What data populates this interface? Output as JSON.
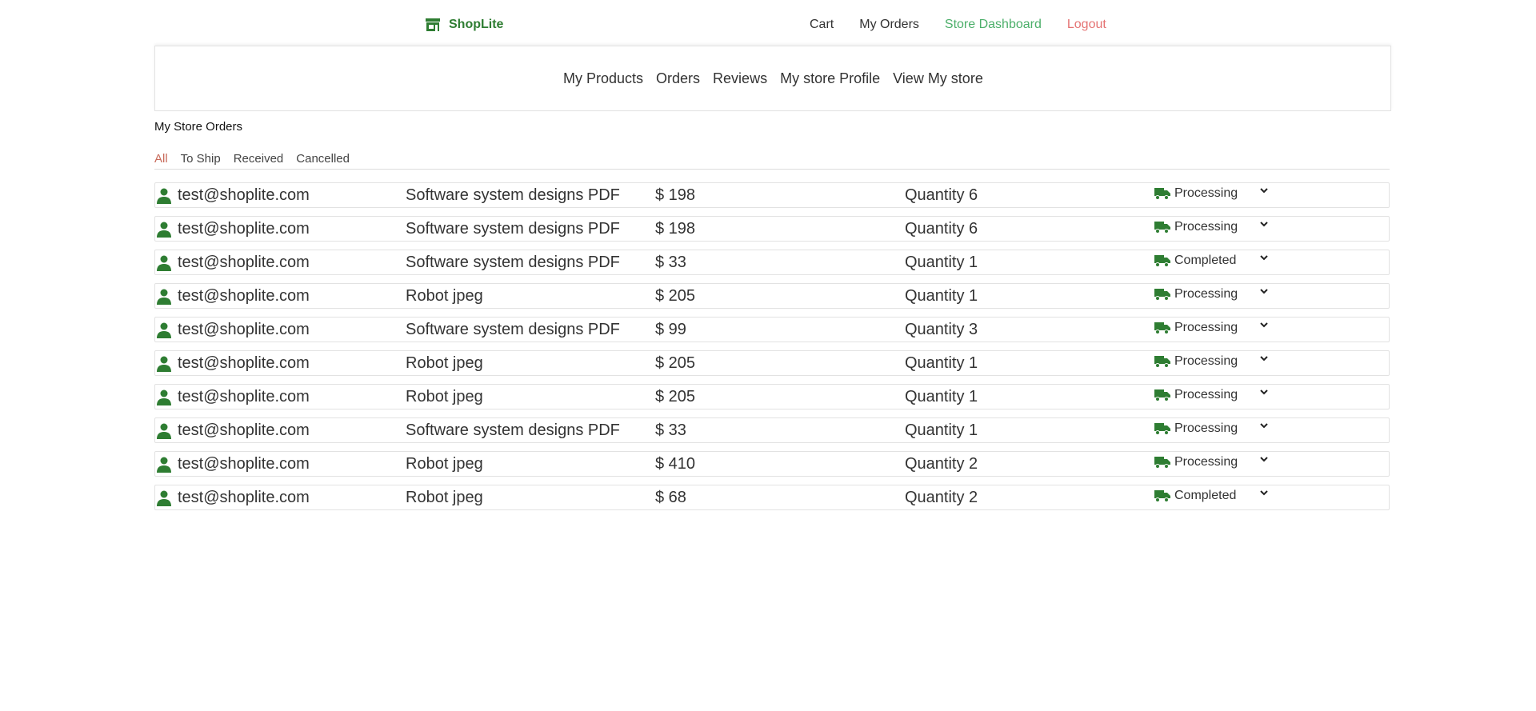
{
  "brand": {
    "name": "ShopLite",
    "icon": "store-icon",
    "color": "#2e7d32"
  },
  "topnav": {
    "cart": "Cart",
    "my_orders": "My Orders",
    "store_dashboard": "Store Dashboard",
    "logout": "Logout"
  },
  "subnav": [
    "My Products",
    "Orders",
    "Reviews",
    "My store Profile",
    "View My store"
  ],
  "section_title": "My Store Orders",
  "filters": [
    "All",
    "To Ship",
    "Received",
    "Cancelled"
  ],
  "active_filter": "All",
  "colors": {
    "accent": "#4caf6a",
    "danger": "#e57373",
    "brand": "#2e7d32",
    "active_filter": "#c86a5a"
  },
  "orders": [
    {
      "email": "test@shoplite.com",
      "product": "Software system designs PDF",
      "price": "$ 198",
      "quantity": "Quantity 6",
      "status": "Processing"
    },
    {
      "email": "test@shoplite.com",
      "product": "Software system designs PDF",
      "price": "$ 198",
      "quantity": "Quantity 6",
      "status": "Processing"
    },
    {
      "email": "test@shoplite.com",
      "product": "Software system designs PDF",
      "price": "$ 33",
      "quantity": "Quantity 1",
      "status": "Completed"
    },
    {
      "email": "test@shoplite.com",
      "product": "Robot jpeg",
      "price": "$ 205",
      "quantity": "Quantity 1",
      "status": "Processing"
    },
    {
      "email": "test@shoplite.com",
      "product": "Software system designs PDF",
      "price": "$ 99",
      "quantity": "Quantity 3",
      "status": "Processing"
    },
    {
      "email": "test@shoplite.com",
      "product": "Robot jpeg",
      "price": "$ 205",
      "quantity": "Quantity 1",
      "status": "Processing"
    },
    {
      "email": "test@shoplite.com",
      "product": "Robot jpeg",
      "price": "$ 205",
      "quantity": "Quantity 1",
      "status": "Processing"
    },
    {
      "email": "test@shoplite.com",
      "product": "Software system designs PDF",
      "price": "$ 33",
      "quantity": "Quantity 1",
      "status": "Processing"
    },
    {
      "email": "test@shoplite.com",
      "product": "Robot jpeg",
      "price": "$ 410",
      "quantity": "Quantity 2",
      "status": "Processing"
    },
    {
      "email": "test@shoplite.com",
      "product": "Robot jpeg",
      "price": "$ 68",
      "quantity": "Quantity 2",
      "status": "Completed"
    }
  ]
}
